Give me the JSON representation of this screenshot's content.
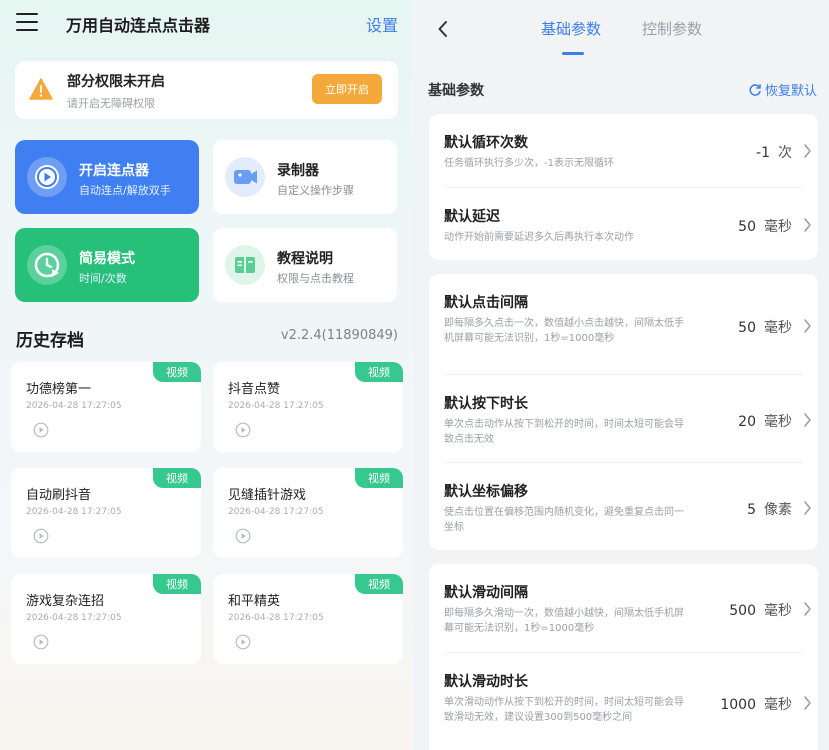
{
  "left": {
    "app_title": "万用自动连点点击器",
    "settings_label": "设置",
    "permission": {
      "title": "部分权限未开启",
      "subtitle": "请开启无障碍权限",
      "button": "立即开启"
    },
    "features": [
      {
        "title": "开启连点器",
        "subtitle": "自动连点/解放双手"
      },
      {
        "title": "录制器",
        "subtitle": "自定义操作步骤"
      },
      {
        "title": "简易模式",
        "subtitle": "时间/次数"
      },
      {
        "title": "教程说明",
        "subtitle": "权限与点击教程"
      }
    ],
    "history_title": "历史存档",
    "version": "v2.2.4(11890849)",
    "history": [
      {
        "name": "功德榜第一",
        "date": "2026-04-28 17:27:05",
        "badge": "视频"
      },
      {
        "name": "抖音点赞",
        "date": "2026-04-28 17:27:05",
        "badge": "视频"
      },
      {
        "name": "自动刷抖音",
        "date": "2026-04-28 17:27:05",
        "badge": "视频"
      },
      {
        "name": "见缝插针游戏",
        "date": "2026-04-28 17:27:05",
        "badge": "视频"
      },
      {
        "name": "游戏复杂连招",
        "date": "2026-04-28 17:27:05",
        "badge": "视频"
      },
      {
        "name": "和平精英",
        "date": "2026-04-28 17:27:05",
        "badge": "视频"
      }
    ]
  },
  "right": {
    "tabs": [
      "基础参数",
      "控制参数"
    ],
    "section_title": "基础参数",
    "reset_label": "恢复默认",
    "settings": [
      {
        "title": "默认循环次数",
        "desc": "任务循环执行多少次，-1表示无限循环",
        "value": "-1",
        "unit": "次"
      },
      {
        "title": "默认延迟",
        "desc": "动作开始前需要延迟多久后再执行本次动作",
        "value": "50",
        "unit": "毫秒"
      },
      {
        "title": "默认点击间隔",
        "desc": "即每隔多久点击一次，数值越小点击越快，间隔太低手机屏幕可能无法识别，1秒=1000毫秒",
        "value": "50",
        "unit": "毫秒"
      },
      {
        "title": "默认按下时长",
        "desc": "单次点击动作从按下到松开的时间，时间太短可能会导致点击无效",
        "value": "20",
        "unit": "毫秒"
      },
      {
        "title": "默认坐标偏移",
        "desc": "使点击位置在偏移范围内随机变化，避免重复点击同一坐标",
        "value": "5",
        "unit": "像素"
      },
      {
        "title": "默认滑动间隔",
        "desc": "即每隔多久滑动一次，数值越小越快，间隔太低手机屏幕可能无法识别，1秒=1000毫秒",
        "value": "500",
        "unit": "毫秒"
      },
      {
        "title": "默认滑动时长",
        "desc": "单次滑动动作从按下到松开的时间，时间太短可能会导致滑动无效，建议设置300到500毫秒之间",
        "value": "1000",
        "unit": "毫秒"
      }
    ]
  },
  "colors": {
    "accent_blue": "#3a7ef0",
    "primary_card_blue": "#3f7ff2",
    "primary_card_green": "#26c07a",
    "warning_orange": "#f4a93a",
    "badge_green": "#36c88f"
  }
}
